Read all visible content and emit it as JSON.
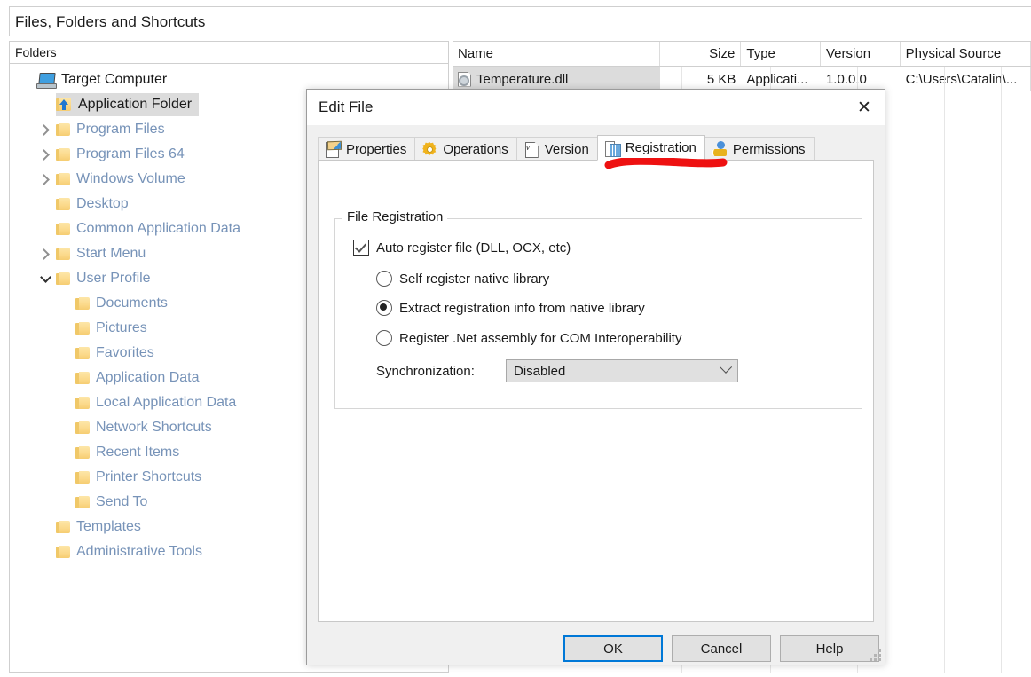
{
  "app": {
    "title": "Files, Folders and Shortcuts",
    "folders_pane_header": "Folders"
  },
  "tree": {
    "items": [
      {
        "label": "Target Computer",
        "icon": "computer-icon",
        "indent": 0,
        "twisty": "none",
        "selected": false,
        "root": true
      },
      {
        "label": "Application Folder",
        "icon": "app-folder-icon",
        "indent": 1,
        "twisty": "none",
        "selected": true,
        "root": false
      },
      {
        "label": "Program Files",
        "icon": "folder-icon",
        "indent": 1,
        "twisty": "right",
        "selected": false,
        "root": false
      },
      {
        "label": "Program Files 64",
        "icon": "folder-icon",
        "indent": 1,
        "twisty": "right",
        "selected": false,
        "root": false
      },
      {
        "label": "Windows Volume",
        "icon": "folder-icon",
        "indent": 1,
        "twisty": "right",
        "selected": false,
        "root": false
      },
      {
        "label": "Desktop",
        "icon": "folder-icon",
        "indent": 1,
        "twisty": "none",
        "selected": false,
        "root": false
      },
      {
        "label": "Common Application Data",
        "icon": "folder-icon",
        "indent": 1,
        "twisty": "none",
        "selected": false,
        "root": false
      },
      {
        "label": "Start Menu",
        "icon": "folder-icon",
        "indent": 1,
        "twisty": "right",
        "selected": false,
        "root": false
      },
      {
        "label": "User Profile",
        "icon": "folder-icon",
        "indent": 1,
        "twisty": "down",
        "selected": false,
        "root": false
      },
      {
        "label": "Documents",
        "icon": "folder-icon",
        "indent": 2,
        "twisty": "none",
        "selected": false,
        "root": false
      },
      {
        "label": "Pictures",
        "icon": "folder-icon",
        "indent": 2,
        "twisty": "none",
        "selected": false,
        "root": false
      },
      {
        "label": "Favorites",
        "icon": "folder-icon",
        "indent": 2,
        "twisty": "none",
        "selected": false,
        "root": false
      },
      {
        "label": "Application Data",
        "icon": "folder-icon",
        "indent": 2,
        "twisty": "none",
        "selected": false,
        "root": false
      },
      {
        "label": "Local Application Data",
        "icon": "folder-icon",
        "indent": 2,
        "twisty": "none",
        "selected": false,
        "root": false
      },
      {
        "label": "Network Shortcuts",
        "icon": "folder-icon",
        "indent": 2,
        "twisty": "none",
        "selected": false,
        "root": false
      },
      {
        "label": "Recent Items",
        "icon": "folder-icon",
        "indent": 2,
        "twisty": "none",
        "selected": false,
        "root": false
      },
      {
        "label": "Printer Shortcuts",
        "icon": "folder-icon",
        "indent": 2,
        "twisty": "none",
        "selected": false,
        "root": false
      },
      {
        "label": "Send To",
        "icon": "folder-icon",
        "indent": 2,
        "twisty": "none",
        "selected": false,
        "root": false
      },
      {
        "label": "Templates",
        "icon": "folder-icon",
        "indent": 1,
        "twisty": "none",
        "selected": false,
        "root": false
      },
      {
        "label": "Administrative Tools",
        "icon": "folder-icon",
        "indent": 1,
        "twisty": "none",
        "selected": false,
        "root": false
      }
    ]
  },
  "file_list": {
    "columns": [
      {
        "label": "Name",
        "key": "name",
        "align": "left"
      },
      {
        "label": "Size",
        "key": "size",
        "align": "right"
      },
      {
        "label": "Type",
        "key": "type",
        "align": "left"
      },
      {
        "label": "Version",
        "key": "version",
        "align": "left"
      },
      {
        "label": "Physical Source",
        "key": "source",
        "align": "left"
      }
    ],
    "rows": [
      {
        "name": "Temperature.dll",
        "size": "5 KB",
        "type": "Applicati...",
        "version": "1.0.0.0",
        "source": "C:\\Users\\Catalin\\...",
        "selected": true
      }
    ]
  },
  "dialog": {
    "title": "Edit File",
    "close_label": "✕",
    "tabs": [
      {
        "label": "Properties",
        "icon": "properties-icon",
        "active": false
      },
      {
        "label": "Operations",
        "icon": "gear-icon",
        "active": false
      },
      {
        "label": "Version",
        "icon": "version-icon",
        "active": false
      },
      {
        "label": "Registration",
        "icon": "registration-icon",
        "active": true
      },
      {
        "label": "Permissions",
        "icon": "permissions-icon",
        "active": false
      }
    ],
    "registration": {
      "group_title": "File Registration",
      "auto_register": {
        "label": "Auto register file (DLL, OCX, etc)",
        "checked": true
      },
      "mode_options": [
        {
          "label": "Self register native library",
          "selected": false
        },
        {
          "label": "Extract registration info from native library",
          "selected": true
        },
        {
          "label": "Register .Net assembly for COM Interoperability",
          "selected": false
        }
      ],
      "synchronization": {
        "label": "Synchronization:",
        "value": "Disabled",
        "options": [
          "Disabled"
        ]
      }
    },
    "buttons": {
      "ok": "OK",
      "cancel": "Cancel",
      "help": "Help"
    }
  },
  "annotation": {
    "type": "freehand-underline",
    "color": "#ee1111",
    "target": "Registration"
  },
  "colors": {
    "accent": "#0078d7",
    "tree_text": "#7793b8",
    "annotation_red": "#ee1111",
    "selection_gray": "#dcdcdc",
    "dialog_bg": "#f0f0f0"
  }
}
